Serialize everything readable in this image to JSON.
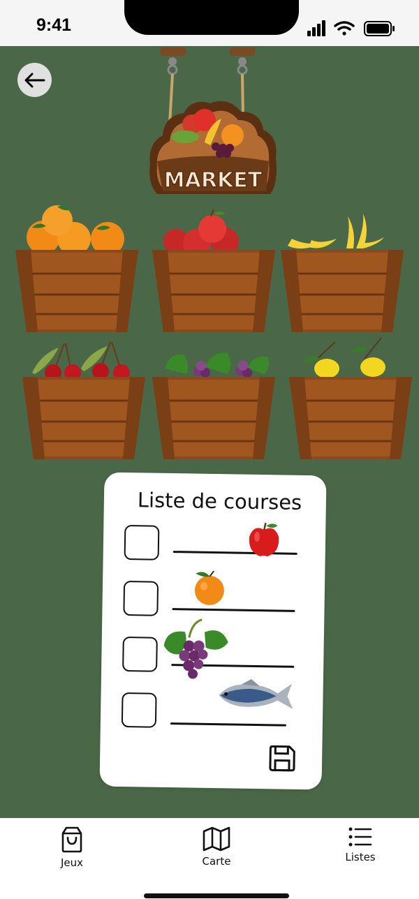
{
  "status_bar": {
    "time": "9:41",
    "icons": [
      "signal-icon",
      "wifi-icon",
      "battery-icon"
    ]
  },
  "header": {
    "back_icon": "arrow-left-icon",
    "sign_text": "MARKET"
  },
  "market": {
    "crates": [
      {
        "fruit": "orange"
      },
      {
        "fruit": "apple"
      },
      {
        "fruit": "banana"
      },
      {
        "fruit": "cherry"
      },
      {
        "fruit": "grape"
      },
      {
        "fruit": "lemon"
      }
    ]
  },
  "shopping_list": {
    "title": "Liste de courses",
    "items": [
      {
        "item": "apple",
        "checked": false
      },
      {
        "item": "orange",
        "checked": false
      },
      {
        "item": "grape",
        "checked": false
      },
      {
        "item": "fish",
        "checked": false
      }
    ],
    "save_icon": "save-icon"
  },
  "tab_bar": {
    "tabs": [
      {
        "label": "Jeux",
        "icon": "shopping-bag-icon"
      },
      {
        "label": "Carte",
        "icon": "map-icon"
      },
      {
        "label": "Listes",
        "icon": "list-icon"
      }
    ]
  },
  "colors": {
    "background": "#4a6847",
    "crate_wood": "#8b4a1c",
    "card": "#ffffff"
  }
}
